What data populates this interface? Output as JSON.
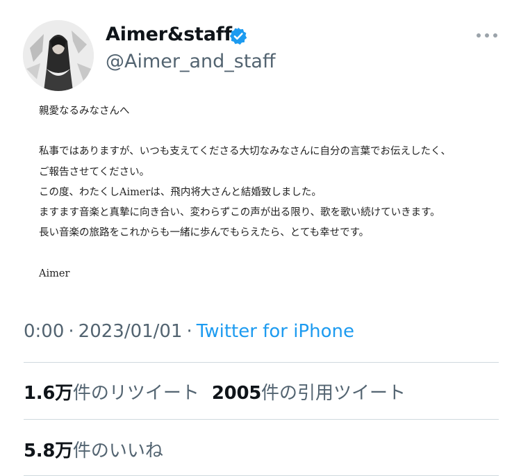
{
  "tweet": {
    "display_name": "Aimer&staff",
    "handle": "@Aimer_and_staff",
    "icons": {
      "verified": "verified-badge-icon",
      "more": "more-options-icon"
    },
    "colors": {
      "verified": "#1d9bf0",
      "link": "#1d9bf0",
      "secondary_text": "#536471"
    },
    "image_text": {
      "greeting": "親愛なるみなさんへ",
      "lines": [
        "私事ではありますが、いつも支えてくださる大切なみなさんに自分の言葉でお伝えしたく、",
        "ご報告させてください。",
        "この度、わたくしAimerは、飛内将大さんと結婚致しました。",
        "ますます音楽と真摯に向き合い、変わらずこの声が出る限り、歌を歌い続けていきます。",
        "長い音楽の旅路をこれからも一緒に歩んでもらえたら、とても幸せです。"
      ],
      "signature": "Aimer"
    },
    "meta": {
      "time": "0:00",
      "separator": "·",
      "date": "2023/01/01",
      "source": "Twitter for iPhone"
    },
    "stats": {
      "retweets_count": "1.6万",
      "retweets_label": "件のリツイート",
      "quotes_count": "2005",
      "quotes_label": "件の引用ツイート",
      "likes_count": "5.8万",
      "likes_label": "件のいいね"
    }
  }
}
